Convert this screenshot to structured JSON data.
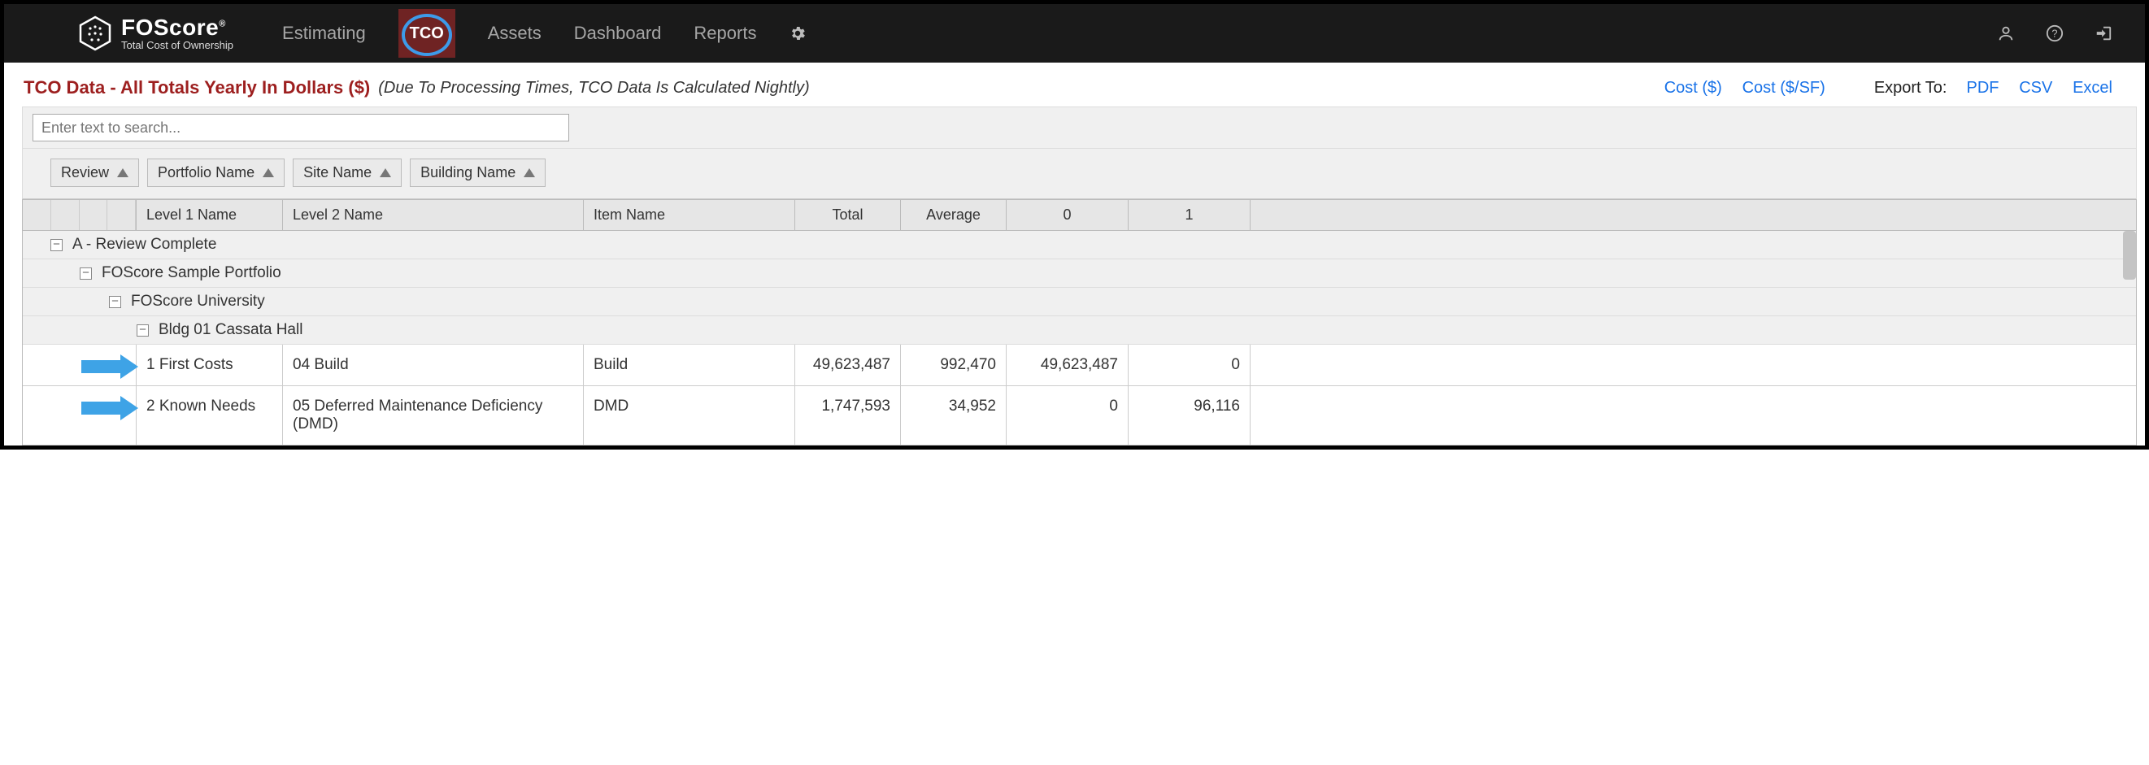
{
  "brand": {
    "name": "FOScore",
    "reg": "®",
    "tagline": "Total Cost of Ownership"
  },
  "nav": {
    "items": [
      "Estimating",
      "TCO",
      "Assets",
      "Dashboard",
      "Reports"
    ],
    "active_index": 1
  },
  "title": {
    "main": "TCO Data - All Totals Yearly In Dollars ($)",
    "note": "(Due To Processing Times, TCO Data Is Calculated Nightly)"
  },
  "view_links": {
    "cost": "Cost ($)",
    "cost_sf": "Cost ($/SF)"
  },
  "export": {
    "label": "Export To:",
    "formats": [
      "PDF",
      "CSV",
      "Excel"
    ]
  },
  "search": {
    "placeholder": "Enter text to search..."
  },
  "group_chips": [
    "Review",
    "Portfolio Name",
    "Site Name",
    "Building Name"
  ],
  "columns": {
    "level1": "Level 1 Name",
    "level2": "Level 2 Name",
    "item": "Item Name",
    "total": "Total",
    "average": "Average",
    "y0": "0",
    "y1": "1"
  },
  "tree": {
    "review": "A - Review Complete",
    "portfolio": "FOScore Sample Portfolio",
    "site": "FOScore University",
    "building": "Bldg 01 Cassata Hall"
  },
  "rows": [
    {
      "level1": "1 First Costs",
      "level2": "04 Build",
      "item": "Build",
      "total": "49,623,487",
      "average": "992,470",
      "y0": "49,623,487",
      "y1": "0"
    },
    {
      "level1": "2 Known Needs",
      "level2": "05 Deferred Maintenance Deficiency (DMD)",
      "item": "DMD",
      "total": "1,747,593",
      "average": "34,952",
      "y0": "0",
      "y1": "96,116"
    }
  ]
}
